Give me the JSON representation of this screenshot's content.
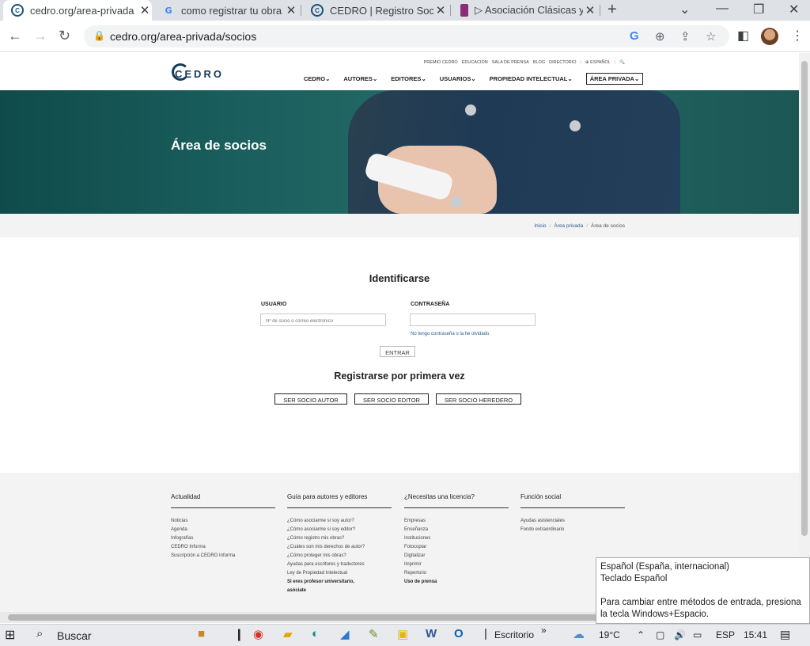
{
  "browser": {
    "tabs": [
      {
        "title": "cedro.org/area-privada",
        "favicon": "cedro-icon",
        "active": true
      },
      {
        "title": "como registrar tu obra",
        "favicon": "google-icon",
        "active": false
      },
      {
        "title": "CEDRO | Registro Socio",
        "favicon": "cedro-icon",
        "active": false
      },
      {
        "title": "▷ Asociación Clásicas y",
        "favicon": "asociacion-icon",
        "active": false
      }
    ],
    "url": "cedro.org/area-privada/socios"
  },
  "site": {
    "logo_text": "CEDRO",
    "top_links": [
      "PREMIO CEDRO",
      "EDUCACIÓN",
      "SALA DE PRENSA",
      "BLOG",
      "DIRECTORIO",
      "|",
      "⊕ ESPAÑOL",
      "|",
      "🔍"
    ],
    "main_nav": [
      "CEDRO",
      "AUTORES",
      "EDITORES",
      "USUARIOS",
      "PROPIEDAD INTELECTUAL",
      "ÁREA PRIVADA"
    ],
    "hero_title": "Área de socios",
    "breadcrumb": [
      "Inicio",
      "/",
      "Área privada",
      "/",
      "Área de socios"
    ],
    "login": {
      "title": "Identificarse",
      "user_label": "USUARIO",
      "user_placeholder": "Nº de socio o correo electrónico",
      "pass_label": "CONTRASEÑA",
      "forgot_link": "No tengo contraseña o la he olvidado",
      "submit": "ENTRAR"
    },
    "register": {
      "title": "Registrarse por primera vez",
      "buttons": [
        "SER SOCIO AUTOR",
        "SER SOCIO EDITOR",
        "SER SOCIO HEREDERO"
      ]
    },
    "footer": {
      "columns": [
        {
          "heading": "Actualidad",
          "items": [
            "Noticias",
            "Agenda",
            "Infografías",
            "CEDRO Informa",
            "Suscripción a CEDRO Informa"
          ]
        },
        {
          "heading": "Guía para autores y editores",
          "items": [
            "¿Cómo asociarme si soy autor?",
            "¿Cómo asociarme si soy editor?",
            "¿Cómo registro mis obras?",
            "¿Cuáles son mis derechos de autor?",
            "¿Cómo proteger mis obras?",
            "Ayudas para escritores y traductores",
            "Ley de Propiedad Intelectual"
          ],
          "bold_items": [
            "Si eres profesor universitario,",
            "asóciate"
          ]
        },
        {
          "heading": "¿Necesitas una licencia?",
          "items": [
            "Empresas",
            "Enseñanza",
            "Instituciones",
            "Fotocopiar",
            "Digitalizar",
            "Imprimir",
            "Repertorio"
          ],
          "bold_items": [
            "Uso de prensa"
          ]
        },
        {
          "heading": "Función social",
          "items": [
            "Ayudas asistenciales",
            "Fondo extraordinario"
          ]
        }
      ]
    }
  },
  "ime_popup": {
    "line1": "Español (España, internacional)",
    "line2": "Teclado Español",
    "line3": "Para cambiar entre métodos de entrada, presiona",
    "line4": "la tecla Windows+Espacio."
  },
  "taskbar": {
    "search_label": "Buscar",
    "desktop_label": "Escritorio",
    "weather": "19°C",
    "language": "ESP",
    "time": "15:41"
  }
}
